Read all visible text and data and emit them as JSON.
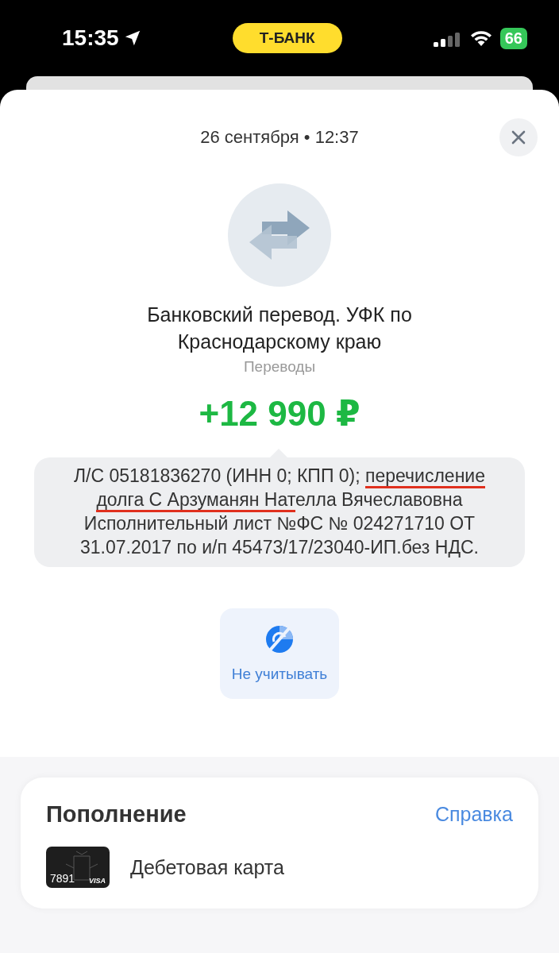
{
  "status_bar": {
    "time": "15:35",
    "carrier_pill": "Т-БАНК",
    "battery": "66"
  },
  "header": {
    "date": "26 сентября • 12:37"
  },
  "operation": {
    "title_lines": [
      "Банковский перевод. УФК по",
      "Краснодарскому краю"
    ],
    "category": "Переводы",
    "amount": "+12 990 ₽"
  },
  "description": {
    "lines": [
      [
        {
          "text": "Л/С 05181836270 (ИНН 0; КПП 0); ",
          "marked": false
        },
        {
          "text": "перечисление",
          "marked": true
        }
      ],
      [
        {
          "text": "долга С Арзуманян Нат",
          "marked": true
        },
        {
          "text": "елла Вячеславовна",
          "marked": false
        }
      ],
      [
        {
          "text": "Исполнительный лист №ФС № 024271710 ОТ",
          "marked": false
        }
      ],
      [
        {
          "text": "31.07.2017 по и/п 45473/17/23040-ИП.без НДС.",
          "marked": false
        }
      ]
    ]
  },
  "actions": [
    {
      "label": "Не учитывать"
    }
  ],
  "section": {
    "title": "Пополнение",
    "link": "Справка",
    "account": {
      "card_number": "7891",
      "card_brand": "VISA",
      "name": "Дебетовая карта"
    }
  }
}
